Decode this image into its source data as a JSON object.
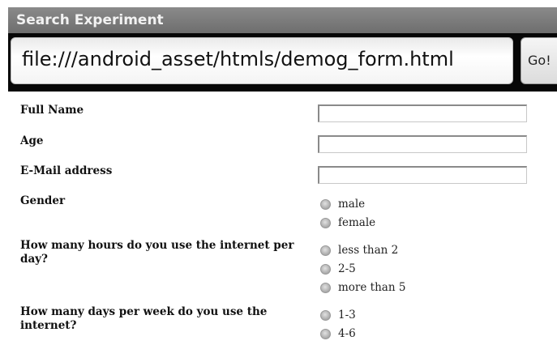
{
  "app": {
    "title": "Search Experiment"
  },
  "urlbar": {
    "value": "file:///android_asset/htmls/demog_form.html",
    "go_label": "Go!"
  },
  "form": {
    "full_name": {
      "label": "Full Name",
      "value": ""
    },
    "age": {
      "label": "Age",
      "value": ""
    },
    "email": {
      "label": "E-Mail address",
      "value": ""
    },
    "gender": {
      "label": "Gender",
      "options": [
        "male",
        "female"
      ]
    },
    "hours_per_day": {
      "label_line1": "How many hours do you use the internet per",
      "label_line2": "day?",
      "options": [
        "less than 2",
        "2-5",
        "more than 5"
      ]
    },
    "days_per_week": {
      "label_line1": "How many days per week do you use the",
      "label_line2": "internet?",
      "options": [
        "1-3",
        "4-6"
      ]
    }
  }
}
